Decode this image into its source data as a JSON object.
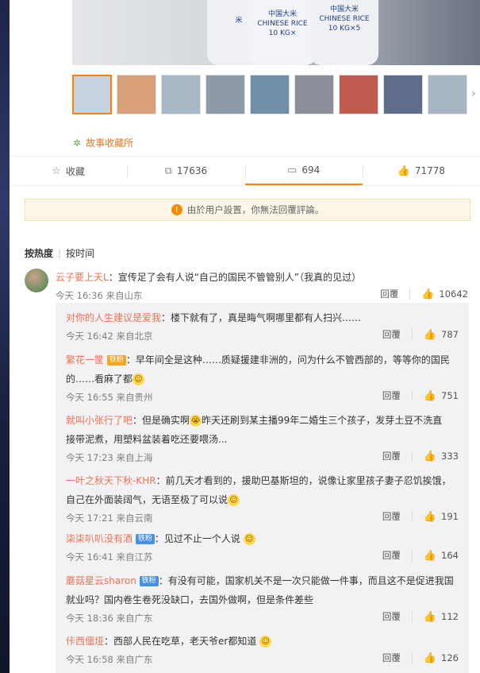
{
  "photo": {
    "sack_left": {
      "line1": "米",
      "line2": "",
      "line3": ""
    },
    "sack_mid": {
      "line1": "中国大米",
      "line2": "CHINESE RICE",
      "line3": "10 KG×"
    },
    "sack_right": {
      "line1": "中国大米",
      "line2": "CHINESE RICE",
      "line3": "10 KG×5"
    }
  },
  "thumbnails": [
    {
      "name": "thumb-1",
      "color": "#c8d2de",
      "selected": true
    },
    {
      "name": "thumb-2",
      "color": "#d9a17a"
    },
    {
      "name": "thumb-3",
      "color": "#a8b8c6"
    },
    {
      "name": "thumb-4",
      "color": "#8e9aa8"
    },
    {
      "name": "thumb-5",
      "color": "#6f8ea8"
    },
    {
      "name": "thumb-6",
      "color": "#8b8f9a"
    },
    {
      "name": "thumb-7",
      "color": "#c05a4e"
    },
    {
      "name": "thumb-8",
      "color": "#5e6e8a"
    },
    {
      "name": "thumb-9",
      "color": "#a7b4c2"
    }
  ],
  "source": {
    "label": "故事收藏所"
  },
  "actions": {
    "favorite": "收藏",
    "repost": "17636",
    "comment": "694",
    "like": "71778"
  },
  "notice": {
    "text": "由於用户設置，你無法回覆評論。"
  },
  "sort": {
    "hot": "按热度",
    "time": "按时间"
  },
  "reply_label": "回覆",
  "main_comment": {
    "user": "云子要上天L",
    "text": "：宣传足了会有人说“自己的国民不管管别人”（我真的见过）",
    "time": "今天 16:36 来自山东",
    "likes": "10642"
  },
  "replies": [
    {
      "user": "对你的人生建议是爱我",
      "text": "：楼下就有了，真是晦气啊哪里都有人扫兴……",
      "text2": "",
      "time": "今天 16:42 来自北京",
      "likes": "787"
    },
    {
      "user": "繁花一筐",
      "badge": "铁粉",
      "text": "：早年间全是这种……质疑援建非洲的，问为什么不管西部的，等等你的国民",
      "text2": "的……看麻了都",
      "time": "今天 16:55 来自贵州",
      "likes": "751"
    },
    {
      "user": "就叫小张行了吧",
      "text": "：但是确实啊",
      "text_b": "昨天还刷到某主播99年二婚生三个孩子，发芽土豆不洗直",
      "text2": "接带泥煮，用塑料盆装着吃还要喂汤...",
      "time": "今天 17:23 来自上海",
      "likes": "333"
    },
    {
      "user": "一叶之秋天下秋-KHR",
      "text": "：前几天才看到的，援助巴基斯坦的，说像让家里孩子妻子忍饥挨饿，",
      "text2": "自己在外面装阔气，无语至极了可以说",
      "time": "今天 17:21 来自云南",
      "likes": "191"
    },
    {
      "user": "柒柒叭叭没有酒",
      "badge": "铁粉",
      "text": "：见过不止一个人说",
      "text2": "",
      "time": "今天 16:41 来自江苏",
      "likes": "164"
    },
    {
      "user": "蘑菇星云sharon",
      "badge": "铁粉",
      "text": "：有没有可能，国家机关不是一次只能做一件事，而且这不是促进我国",
      "text2": "就业吗？国内卷生卷死没缺口，去国外做啊，但是条件差些",
      "time": "今天 18:36 来自广东",
      "likes": "112"
    },
    {
      "user": "佧西僵垭",
      "text": "：西部人民在吃草，老天爷er都知道",
      "text2": "",
      "time": "今天 16:58 来自广东",
      "likes": "126"
    }
  ]
}
